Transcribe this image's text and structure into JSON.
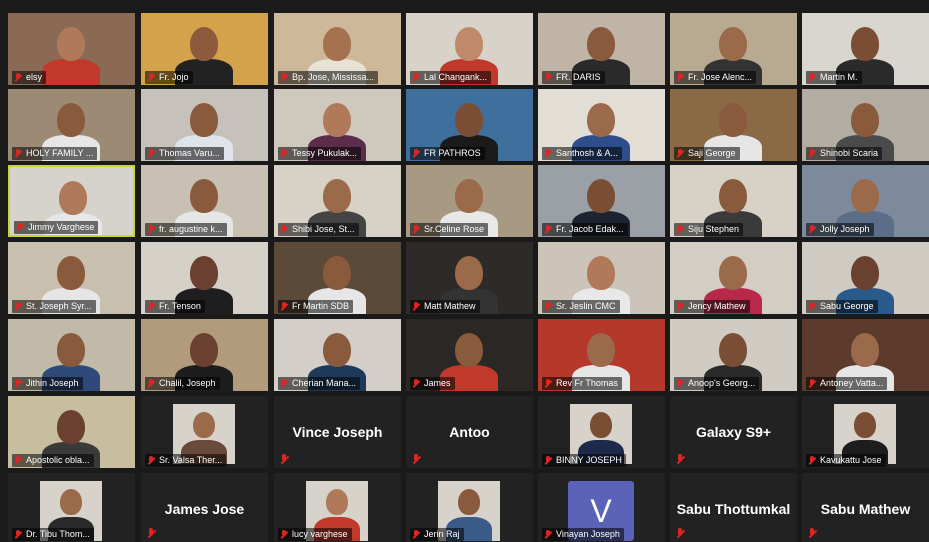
{
  "participants": [
    {
      "name": "elsy",
      "bg": "#8a6a55",
      "skin": "#b07a5a",
      "shirt": "#c0392b"
    },
    {
      "name": "Fr. Jojo",
      "bg": "#d4a24a",
      "skin": "#8d5a3b",
      "shirt": "#222"
    },
    {
      "name": "Bp. Jose, Mississa...",
      "bg": "#cdb99a",
      "skin": "#a5714f",
      "shirt": "#e8e2d6"
    },
    {
      "name": "Lal Changank...",
      "bg": "#d8d2c8",
      "skin": "#c08a6a",
      "shirt": "#c0392b"
    },
    {
      "name": "FR. DARIS",
      "bg": "#bfb4a6",
      "skin": "#8a5a3c",
      "shirt": "#2a2a2a"
    },
    {
      "name": "Fr. Jose Alenc...",
      "bg": "#b8aa90",
      "skin": "#9a6a4a",
      "shirt": "#333"
    },
    {
      "name": "Martin M.",
      "bg": "#d9d6cf",
      "skin": "#7a4e34",
      "shirt": "#2a2a2a"
    },
    {
      "name": "HOLY FAMILY ...",
      "bg": "#9c8a75",
      "skin": "#8a5a3c",
      "shirt": "#e6e6e6"
    },
    {
      "name": "Thomas Varu...",
      "bg": "#c6c2bb",
      "skin": "#8a5a3c",
      "shirt": "#dfe3ea"
    },
    {
      "name": "Tessy Pukulak...",
      "bg": "#cfc8bd",
      "skin": "#b07a5a",
      "shirt": "#5a2d4a"
    },
    {
      "name": "FR PATHROS",
      "bg": "#3f6f9c",
      "skin": "#7a4e34",
      "shirt": "#1a1a1a"
    },
    {
      "name": "Santhosh & A...",
      "bg": "#e2ddd5",
      "skin": "#9a6a4a",
      "shirt": "#2d4e8a"
    },
    {
      "name": "Saji George",
      "bg": "#8a6a45",
      "skin": "#8a5a3c",
      "shirt": "#e6e6e6"
    },
    {
      "name": "Shinobi Scaria",
      "bg": "#b2aca2",
      "skin": "#8a5a3c",
      "shirt": "#4a4a4a"
    },
    {
      "name": "Jimmy Varghese",
      "bg": "#d6d3cc",
      "skin": "#b07a5a",
      "shirt": "#e8e8e8"
    },
    {
      "name": "fr. augustine k...",
      "bg": "#c8c0b3",
      "skin": "#8a5a3c",
      "shirt": "#e6e6e6"
    },
    {
      "name": "Shibi Jose, St...",
      "bg": "#d7d1c6",
      "skin": "#9a6a4a",
      "shirt": "#444"
    },
    {
      "name": "Sr.Celine Rose",
      "bg": "#a89a82",
      "skin": "#9a6a4a",
      "shirt": "#e8e8e8"
    },
    {
      "name": "Fr. Jacob Edak...",
      "bg": "#9aa0a6",
      "skin": "#7a4e34",
      "shirt": "#1d2330"
    },
    {
      "name": "Siju Stephen",
      "bg": "#d8d2c6",
      "skin": "#8a5a3c",
      "shirt": "#3a3a3a"
    },
    {
      "name": "Jolly Joseph",
      "bg": "#7d8a9c",
      "skin": "#9a6a4a",
      "shirt": "#5a6e8a"
    },
    {
      "name": "St. Joseph Syr...",
      "bg": "#c9bfae",
      "skin": "#8a5a3c",
      "shirt": "#e6e6e6"
    },
    {
      "name": "Fr. Tenson",
      "bg": "#d5d0c8",
      "skin": "#6a4030",
      "shirt": "#1e1e1e"
    },
    {
      "name": "Fr Martin SDB",
      "bg": "#5c4a38",
      "skin": "#8a5a3c",
      "shirt": "#e6e6e6"
    },
    {
      "name": "Matt Mathew",
      "bg": "#2d2a27",
      "skin": "#9a6a4a",
      "shirt": "#333"
    },
    {
      "name": "Sr. Jeslin CMC",
      "bg": "#ccc4b8",
      "skin": "#b07a5a",
      "shirt": "#e8e8e8"
    },
    {
      "name": "Jency Mathew",
      "bg": "#d3cdc3",
      "skin": "#9a6a4a",
      "shirt": "#b8284a"
    },
    {
      "name": "Sabu George",
      "bg": "#cfcac2",
      "skin": "#6a4030",
      "shirt": "#2a5a8a"
    },
    {
      "name": "Jithin Joseph",
      "bg": "#c2baa8",
      "skin": "#8a5a3c",
      "shirt": "#2d4a7a"
    },
    {
      "name": "Chalil, Joseph",
      "bg": "#b29a7c",
      "skin": "#6a4030",
      "shirt": "#1d1d1d"
    },
    {
      "name": "Cherian Mana...",
      "bg": "#d3cfc8",
      "skin": "#8a5a3c",
      "shirt": "#1e3a5a"
    },
    {
      "name": "James",
      "bg": "#2a2724",
      "skin": "#8a5a3c",
      "shirt": "#c0392b"
    },
    {
      "name": "Rev Fr Thomas",
      "bg": "#b5392b",
      "skin": "#9a6a4a",
      "shirt": "#e6e6e6"
    },
    {
      "name": "Anoop's Georg...",
      "bg": "#d0ccc4",
      "skin": "#7a4e34",
      "shirt": "#2a2a2a"
    },
    {
      "name": "Antoney Vatta...",
      "bg": "#5c3a2c",
      "skin": "#9a6a4a",
      "shirt": "#e6e6e6"
    },
    {
      "name": "Apostolic obla...",
      "bg": "#c7bd9f",
      "skin": "#6a4030",
      "shirt": "#3a3a3a"
    },
    {
      "name": "Sr. Valsa Ther...",
      "bg": "#222",
      "skin": "#9a6a4a",
      "shirt": "#6a4a3a",
      "small": true
    },
    {
      "name": "Vince Joseph",
      "textonly": true
    },
    {
      "name": "Antoo",
      "textonly": true
    },
    {
      "name": "BINNY JOSEPH",
      "bg": "#222",
      "skin": "#7a4e34",
      "shirt": "#1e2a4a",
      "small": true
    },
    {
      "name": "Galaxy S9+",
      "textonly": true
    },
    {
      "name": "Kavukattu Jose",
      "bg": "#222",
      "skin": "#7a4e34",
      "shirt": "#1d1d1d",
      "small": true
    },
    {
      "name": "Dr. Tibu Thom...",
      "bg": "#222",
      "skin": "#9a6a4a",
      "shirt": "#2a2a2a",
      "small": true
    },
    {
      "name": "James Jose",
      "textonly": true
    },
    {
      "name": "lucy varghese",
      "bg": "#222",
      "skin": "#b07a5a",
      "shirt": "#c0392b",
      "small": true
    },
    {
      "name": "Jerin Raj",
      "bg": "#222",
      "skin": "#8a5a3c",
      "shirt": "#3a5a8a",
      "small": true
    },
    {
      "name": "Vinayan Joseph",
      "vletter": "V"
    },
    {
      "name": "Sabu Thottumkal",
      "textonly": true
    },
    {
      "name": "Sabu Mathew",
      "textonly": true
    }
  ],
  "active_speaker_index": 14,
  "colors": {
    "mute": "#e02424",
    "active_border": "#c9d63a",
    "tile_bg": "#222"
  }
}
